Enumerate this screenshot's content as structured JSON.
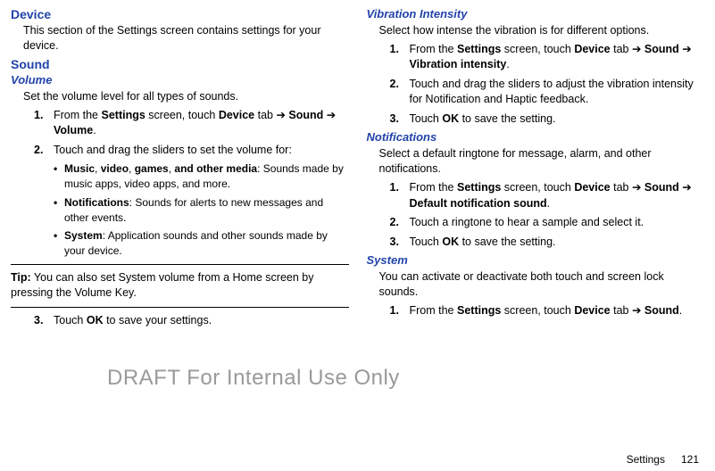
{
  "left": {
    "device_heading": "Device",
    "device_desc": "This section of the Settings screen contains settings for your device.",
    "sound_heading": "Sound",
    "volume_heading": "Volume",
    "volume_desc": "Set the volume level for all types of sounds.",
    "vol_step1_num": "1.",
    "vol_step1_prefix": "From the ",
    "vol_step1_settings": "Settings",
    "vol_step1_mid1": " screen, touch ",
    "vol_step1_device": "Device",
    "vol_step1_mid2": " tab ",
    "vol_step1_arrow1": "➔",
    "vol_step1_sound": " Sound ",
    "vol_step1_arrow2": "➔",
    "vol_step1_volume": " Volume",
    "vol_step1_period": ".",
    "vol_step2_num": "2.",
    "vol_step2_text": "Touch and drag the sliders to set the volume for:",
    "bullet1_bold": "Music",
    "bullet1_c1": ", ",
    "bullet1_video": "video",
    "bullet1_c2": ", ",
    "bullet1_games": "games",
    "bullet1_c3": ", ",
    "bullet1_other": "and other media",
    "bullet1_rest": ": Sounds made by music apps, video apps, and more.",
    "bullet2_bold": "Notifications",
    "bullet2_rest": ": Sounds for alerts to new messages and other events.",
    "bullet3_bold": "System",
    "bullet3_rest": ": Application sounds and other sounds made by your device.",
    "tip_label": "Tip:",
    "tip_text": " You can also set System volume from a Home screen by pressing the Volume Key.",
    "vol_step3_num": "3.",
    "vol_step3_prefix": "Touch ",
    "vol_step3_ok": "OK",
    "vol_step3_rest": " to save your settings."
  },
  "right": {
    "vib_heading": "Vibration Intensity",
    "vib_desc": "Select how intense the vibration is for different options.",
    "vib_step1_num": "1.",
    "vib_step1_prefix": "From the ",
    "vib_step1_settings": "Settings",
    "vib_step1_mid1": " screen, touch ",
    "vib_step1_device": "Device",
    "vib_step1_mid2": " tab ",
    "vib_step1_arrow1": "➔",
    "vib_step1_sound": " Sound ",
    "vib_step1_arrow2": "➔",
    "vib_step1_vibint": " Vibration intensity",
    "vib_step1_period": ".",
    "vib_step2_num": "2.",
    "vib_step2_text": "Touch and drag the sliders to adjust the vibration intensity for Notification and Haptic feedback.",
    "vib_step3_num": "3.",
    "vib_step3_prefix": "Touch ",
    "vib_step3_ok": "OK",
    "vib_step3_rest": " to save the setting.",
    "notif_heading": "Notifications",
    "notif_desc": "Select a default ringtone for message, alarm, and other notifications.",
    "notif_step1_num": "1.",
    "notif_step1_prefix": "From the ",
    "notif_step1_settings": "Settings",
    "notif_step1_mid1": " screen, touch ",
    "notif_step1_device": "Device",
    "notif_step1_mid2": " tab ",
    "notif_step1_arrow1": "➔",
    "notif_step1_sound": " Sound ",
    "notif_step1_arrow2": "➔",
    "notif_step1_default": " Default notification sound",
    "notif_step1_period": ".",
    "notif_step2_num": "2.",
    "notif_step2_text": "Touch a ringtone to hear a sample and select it.",
    "notif_step3_num": "3.",
    "notif_step3_prefix": "Touch ",
    "notif_step3_ok": "OK",
    "notif_step3_rest": " to save the setting.",
    "system_heading": "System",
    "system_desc": "You can activate or deactivate both touch and screen lock sounds.",
    "sys_step1_num": "1.",
    "sys_step1_prefix": "From the ",
    "sys_step1_settings": "Settings",
    "sys_step1_mid1": " screen, touch ",
    "sys_step1_device": "Device",
    "sys_step1_mid2": " tab ",
    "sys_step1_arrow": "➔",
    "sys_step1_sound": " Sound",
    "sys_step1_period": "."
  },
  "watermark": "DRAFT For Internal Use Only",
  "footer_label": "Settings",
  "footer_page": "121"
}
